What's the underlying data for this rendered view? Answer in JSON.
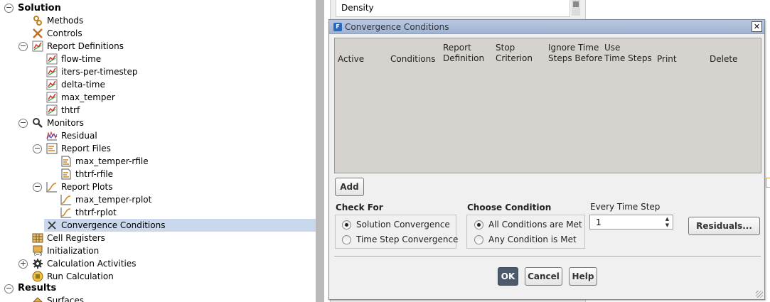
{
  "tree": {
    "solution": "Solution",
    "methods": "Methods",
    "controls": "Controls",
    "report_definitions": "Report Definitions",
    "flow_time": "flow-time",
    "iters_per_timestep": "iters-per-timestep",
    "delta_time": "delta-time",
    "max_temper": "max_temper",
    "thtrf": "thtrf",
    "monitors": "Monitors",
    "residual": "Residual",
    "report_files": "Report Files",
    "max_temper_rfile": "max_temper-rfile",
    "thtrf_rfile": "thtrf-rfile",
    "report_plots": "Report Plots",
    "max_temper_rplot": "max_temper-rplot",
    "thtrf_rplot": "thtrf-rplot",
    "convergence_conditions": "Convergence Conditions",
    "cell_registers": "Cell Registers",
    "initialization": "Initialization",
    "calculation_activities": "Calculation Activities",
    "run_calculation": "Run Calculation",
    "results": "Results",
    "surfaces": "Surfaces"
  },
  "panel": {
    "density_label": "Density"
  },
  "dialog": {
    "title": "Convergence Conditions",
    "app_icon": "F",
    "close": "✕",
    "columns": {
      "active": "Active",
      "conditions": "Conditions",
      "report_definition": [
        "Report",
        "Definition"
      ],
      "stop_criterion": [
        "Stop",
        "Criterion"
      ],
      "ignore_time_steps_before": [
        "Ignore Time",
        "Steps Before"
      ],
      "use_time_steps": [
        "Use",
        "Time Steps"
      ],
      "print": "Print",
      "delete": "Delete"
    },
    "add_label": "Add",
    "check_for": {
      "label": "Check For",
      "options": [
        "Solution Convergence",
        "Time Step Convergence"
      ],
      "selected": "Solution Convergence"
    },
    "choose_condition": {
      "label": "Choose Condition",
      "options": [
        "All Conditions are Met",
        "Any Condition is Met"
      ],
      "selected": "All Conditions are Met"
    },
    "every_time_step": {
      "label": "Every Time Step",
      "value": "1"
    },
    "residuals_label": "Residuals...",
    "ok_label": "OK",
    "cancel_label": "Cancel",
    "help_label": "Help"
  },
  "colors": {
    "selection": "#c9d8ec",
    "dialog_bg": "#f0f0f0",
    "table_bg": "#d6d3ce",
    "ok_button": "#4d5a6c"
  }
}
